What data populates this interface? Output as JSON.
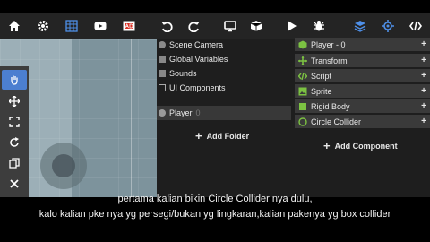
{
  "toolbar": {
    "icons": [
      "home-icon",
      "gear-icon",
      "grid-icon",
      "youtube-icon",
      "ad-icon",
      "undo-icon",
      "redo-icon",
      "monitor-icon",
      "cube-icon",
      "play-icon",
      "bug-icon",
      "layers-icon",
      "target-icon",
      "code-icon"
    ]
  },
  "viewport": {
    "tools": [
      "hand-icon",
      "move-icon",
      "scale-icon",
      "rotate-icon",
      "duplicate-icon",
      "delete-icon"
    ]
  },
  "hierarchy": {
    "items": [
      {
        "label": "Scene Camera"
      },
      {
        "label": "Global Variables"
      },
      {
        "label": "Sounds"
      },
      {
        "label": "UI Components"
      }
    ],
    "selected": {
      "label": "Player",
      "index": "0"
    },
    "add_folder": "Add Folder"
  },
  "inspector": {
    "object": "Player - 0",
    "components": [
      {
        "label": "Transform"
      },
      {
        "label": "Script"
      },
      {
        "label": "Sprite"
      },
      {
        "label": "Rigid Body"
      },
      {
        "label": "Circle Collider"
      }
    ],
    "add_component": "Add Component",
    "accent_color": "#7cc242"
  },
  "subtitles": [
    "pertama kalian bikin Circle Collider nya dulu,",
    "kalo kalian pke nya yg persegi/bukan yg lingkaran,kalian pakenya yg box collider"
  ]
}
